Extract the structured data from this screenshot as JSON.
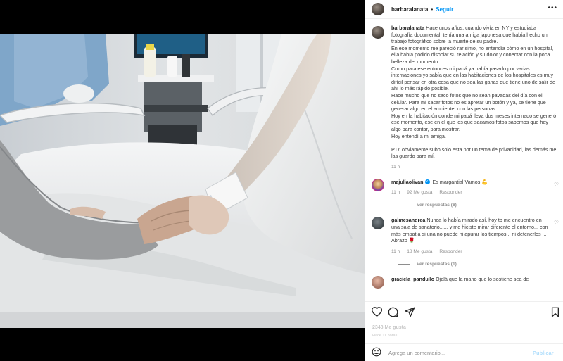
{
  "post": {
    "username": "barbaralanata",
    "follow_label": "Seguir",
    "separator": "•",
    "more_label": "•••"
  },
  "caption": {
    "username": "barbaralanata",
    "para1": "Hace unos años, cuando vivía en NY y estudiaba fotografía documental, tenía una amiga japonesa que había hecho un trabajo fotográfico sobre la muerte de su padre.",
    "para2": "En ese momento me pareció rarísimo, no entendía cómo en un hospital, ella había podido disociar su relación y su dolor y conectar con la poca belleza del momento.",
    "para3": "Como para ese entonces mi papá ya había pasado por varias internaciones yo sabía que en las habitaciones de los hospitales es muy difícil pensar en otra cosa que no sea las ganas que tiene uno de salir de ahí lo más rápido posible.",
    "para4": "Hace mucho que no saco fotos que no sean pavadas del día con el celular. Para mí sacar fotos no es apretar un botón y ya, se tiene que generar algo en el ambiente, con las personas.",
    "para5": "Hoy en la habitación donde mi papá lleva dos meses internado se generó ese momento, ese en el que los que sacamos fotos sabemos que hay algo para contar, para mostrar.",
    "para6": "Hoy entendí a mi amiga.",
    "para7": "P.D: obviamente subo solo esta por un tema de privacidad, las demás me las guardo para mí.",
    "time": "11 h"
  },
  "comments": [
    {
      "username": "majuliaolivan",
      "text": "Es margantial Vamos 💪",
      "time": "11 h",
      "likes": "92 Me gusta",
      "reply_label": "Responder",
      "replies_label": "Ver respuestas (6)"
    },
    {
      "username": "galmesandrea",
      "text": "Nunca lo había mirado así, hoy tb me encuentro en una sala de sanatorio...... y me hiciste mirar diferente el entorno... con más empatía si una no puede ni apurar los tiempos... ni detenerlos ... Abrazo 🌹",
      "time": "11 h",
      "likes": "18 Me gusta",
      "reply_label": "Responder",
      "replies_label": "Ver respuestas (1)"
    },
    {
      "username": "graciela_pandullo",
      "text": "Ojalá que la mano que lo sostiene sea de"
    }
  ],
  "actions": {
    "likes": "2348 Me gusta",
    "date": "Hace 11 horas"
  },
  "add_comment": {
    "placeholder": "Agrega un comentario...",
    "publish_label": "Publicar"
  },
  "icons": {
    "like": "heart-icon",
    "comment": "comment-icon",
    "share": "share-icon",
    "save": "bookmark-icon",
    "emoji": "emoji-icon",
    "more": "more-options-icon"
  },
  "colors": {
    "follow": "#0095f6",
    "publish_disabled": "#b2dffc",
    "background": "#000000"
  }
}
